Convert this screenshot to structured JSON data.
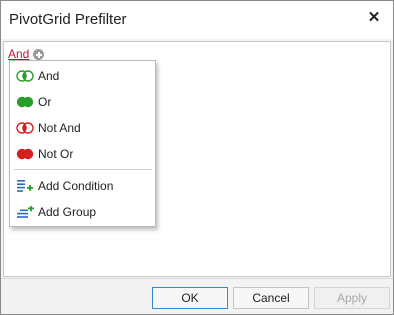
{
  "window": {
    "title": "PivotGrid Prefilter",
    "close_label": "✕"
  },
  "editor": {
    "root_group_operator": "And"
  },
  "menu": {
    "items": [
      {
        "label": "And",
        "icon": "and-icon"
      },
      {
        "label": "Or",
        "icon": "or-icon"
      },
      {
        "label": "Not And",
        "icon": "not-and-icon"
      },
      {
        "label": "Not Or",
        "icon": "not-or-icon"
      },
      {
        "label": "Add Condition",
        "icon": "add-condition-icon"
      },
      {
        "label": "Add Group",
        "icon": "add-group-icon"
      }
    ]
  },
  "footer": {
    "ok_label": "OK",
    "cancel_label": "Cancel",
    "apply_label": "Apply"
  },
  "colors": {
    "operator_red": "#c8102e",
    "green": "#2a9d2a",
    "red": "#d42020",
    "blue": "#2b6cb8",
    "ok_border": "#3a86d4"
  }
}
